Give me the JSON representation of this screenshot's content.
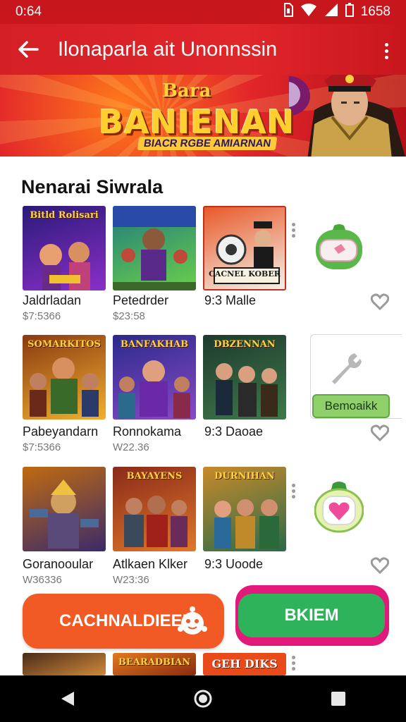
{
  "status_bar": {
    "time": "0:64",
    "right_text": "1658"
  },
  "app_bar": {
    "title": "Ilonaparla ait Unonnssin"
  },
  "banner": {
    "small_text": "Bara",
    "big_text": "BANIENAN",
    "sub_text": "BIACR RGBE AMIARNAN"
  },
  "section": {
    "title": "Nenarai Siwrala"
  },
  "games": [
    {
      "title": "Jaldrladan",
      "price": "$7:5366",
      "badge": "Bitld Rolisari",
      "colors": [
        "#2a1a78",
        "#8a2fc8"
      ]
    },
    {
      "title": "Petedrder",
      "price": "$23:58",
      "badge": "",
      "colors": [
        "#1f7a7e",
        "#6ad04a"
      ]
    },
    {
      "title": "9:3 Malle",
      "price": "",
      "badge": "CACNEL KOBER",
      "colors": [
        "#e85a2a",
        "#1a1a1a"
      ]
    },
    {
      "title": "Pabeyandarn",
      "price": "$7:5366",
      "badge": "SOMARKITOS",
      "colors": [
        "#8a3a10",
        "#f0b030"
      ]
    },
    {
      "title": "Ronnokama",
      "price": "W22.36",
      "badge": "BANFAKHAB",
      "colors": [
        "#2a2a8a",
        "#8a4ac8"
      ]
    },
    {
      "title": "9:3 Daoae",
      "price": "",
      "badge": "DBZENNAN",
      "colors": [
        "#1e3a2e",
        "#3e7a4a"
      ]
    },
    {
      "title": "Goranooular",
      "price": "W36336",
      "badge": "",
      "colors": [
        "#c06a10",
        "#3a2a6a"
      ]
    },
    {
      "title": "Atlkaen Klker",
      "price": "W23:36",
      "badge": "BAYAYENS",
      "colors": [
        "#8a2a1a",
        "#e0782a"
      ]
    },
    {
      "title": "9:3 Uoode",
      "price": "",
      "badge": "DURNIHAN",
      "colors": [
        "#c88a2a",
        "#2a6a4a"
      ]
    },
    {
      "title": "",
      "price": "",
      "badge": "",
      "colors": [
        "#4a2a1a",
        "#d08a3a"
      ]
    },
    {
      "title": "",
      "price": "",
      "badge": "BEARADBIAN",
      "colors": [
        "#e07a20",
        "#8a2a10"
      ]
    },
    {
      "title": "",
      "price": "",
      "badge": "GEH DIKS",
      "colors": [
        "#e84a1a",
        "#ffffff"
      ]
    }
  ],
  "side_card": {
    "button_label": "Bemoaikk"
  },
  "actions": {
    "primary_label": "CACHNALDIEEI",
    "secondary_label": "BKIEM"
  },
  "theme": {
    "accent": "#d41f25",
    "orange": "#f15a24",
    "green": "#2fb35a",
    "magenta": "#e2187b"
  }
}
